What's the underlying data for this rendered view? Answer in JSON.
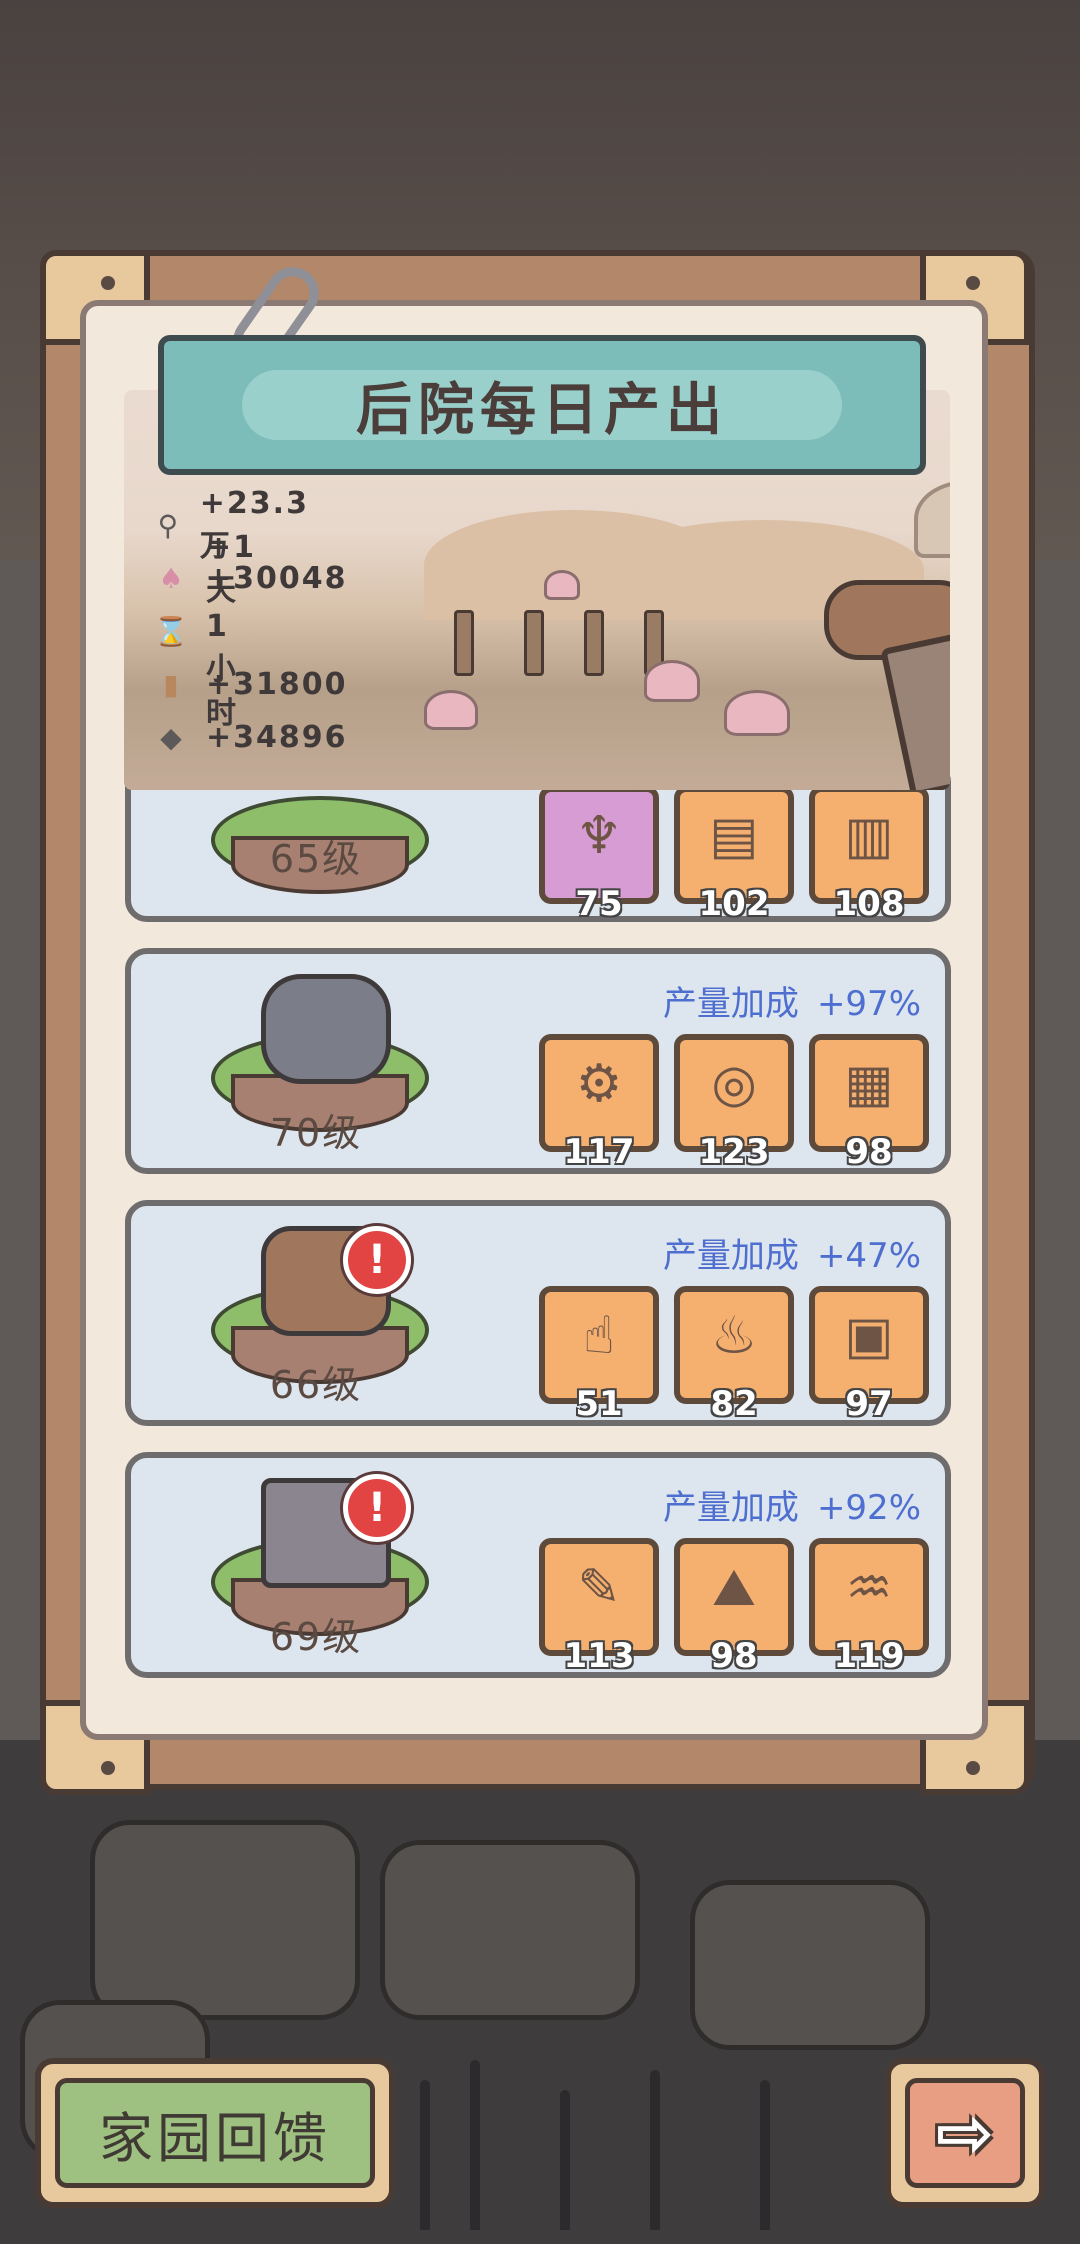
{
  "header": {
    "title": "后院每日产出"
  },
  "stats": [
    {
      "icon": "ore-icon",
      "glyph": "⚲",
      "value": "+23.3万"
    },
    {
      "icon": "mushroom-icon",
      "glyph": "♠",
      "value": "+30048"
    },
    {
      "icon": "hourglass-icon",
      "glyph": "⌛",
      "value": "+1天1小时"
    },
    {
      "icon": "wood-icon",
      "glyph": "▮",
      "value": "+31800"
    },
    {
      "icon": "stone-icon",
      "glyph": "◆",
      "value": "+34896"
    }
  ],
  "cards": [
    {
      "level": "65级",
      "bonus_label": "",
      "bonus_value": "",
      "items": [
        {
          "name": "spinning-top-icon",
          "glyph": "♆",
          "count": "75",
          "bg": "purple"
        },
        {
          "name": "book-icon",
          "glyph": "▤",
          "count": "102",
          "bg": "orange"
        },
        {
          "name": "scroll-icon",
          "glyph": "▥",
          "count": "108",
          "bg": "orange"
        }
      ]
    },
    {
      "level": "70级",
      "bonus_label": "产量加成",
      "bonus_value": "+97%",
      "items": [
        {
          "name": "machine-icon",
          "glyph": "⚙",
          "count": "117",
          "bg": "orange"
        },
        {
          "name": "shield-icon",
          "glyph": "◎",
          "count": "123",
          "bg": "orange"
        },
        {
          "name": "document-icon",
          "glyph": "▦",
          "count": "98",
          "bg": "orange"
        }
      ]
    },
    {
      "level": "66级",
      "bonus_label": "产量加成",
      "bonus_value": "+47%",
      "items": [
        {
          "name": "trophy-hand-icon",
          "glyph": "☝",
          "count": "51",
          "bg": "orange"
        },
        {
          "name": "torch-icon",
          "glyph": "♨",
          "count": "82",
          "bg": "orange"
        },
        {
          "name": "blocks-icon",
          "glyph": "▣",
          "count": "97",
          "bg": "orange"
        }
      ]
    },
    {
      "level": "69级",
      "bonus_label": "产量加成",
      "bonus_value": "+92%",
      "items": [
        {
          "name": "map-scroll-icon",
          "glyph": "✎",
          "count": "113",
          "bg": "orange"
        },
        {
          "name": "ore-rocks-icon",
          "glyph": "⛰",
          "count": "98",
          "bg": "orange"
        },
        {
          "name": "magic-lamp-icon",
          "glyph": "♒",
          "count": "119",
          "bg": "orange"
        }
      ]
    }
  ],
  "buttons": {
    "home_feedback": "家园回馈",
    "next_arrow": "⇨"
  },
  "colors": {
    "bonus_text": "#4e6fd0",
    "alert": "#e24443",
    "banner": "#7cbcb9"
  }
}
